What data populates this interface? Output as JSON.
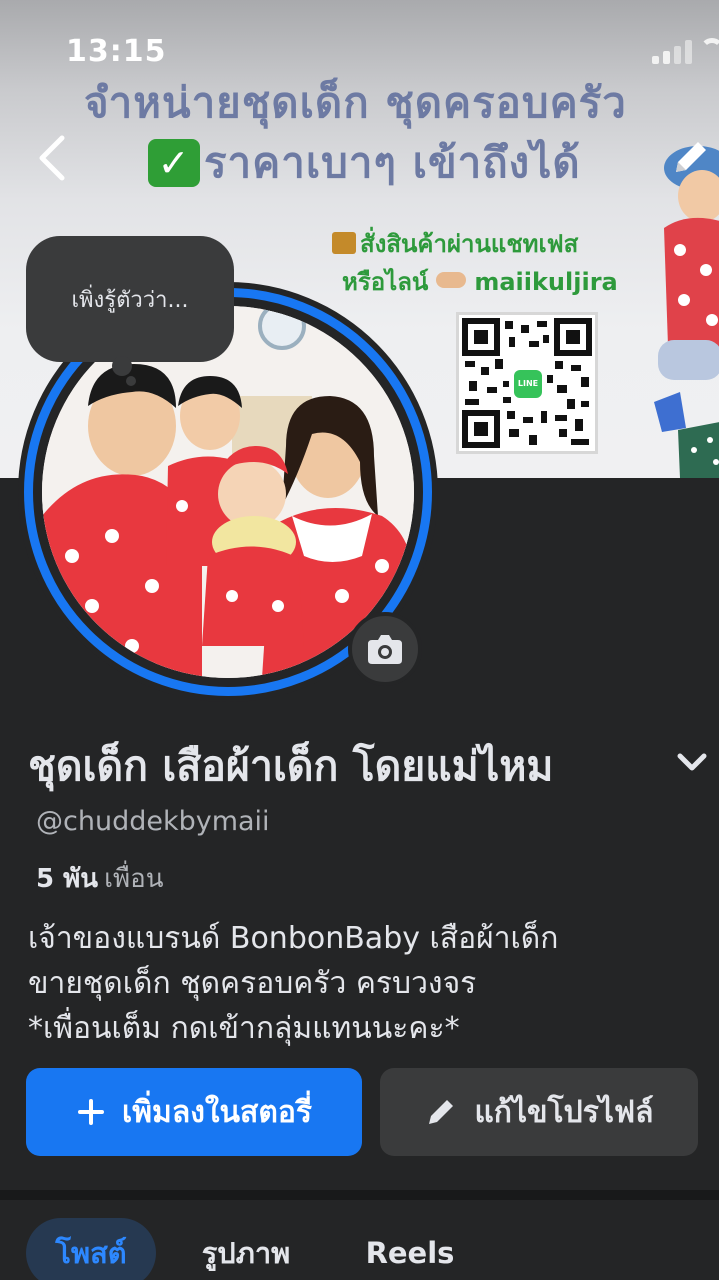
{
  "status_bar": {
    "time": "13:15"
  },
  "cover": {
    "headline_line1": "จำหน่ายชุดเด็ก ชุดครอบครัว",
    "headline_line2_check": "✅",
    "headline_line2": "ราคาเบาๆ เข้าถึงได้",
    "order_line1": "สั่งสินค้าผ่านแชทเฟส",
    "order_line2_prefix": "หรือไลน์",
    "order_line2_id": "maiikuljira",
    "qr_logo_text": "LINE"
  },
  "note": {
    "text": "เพิ่งรู้ตัวว่า..."
  },
  "profile": {
    "name": "ชุดเด็ก เสือผ้าเด็ก โดยแม่ไหม",
    "handle": "@chuddekbymaii",
    "friends_count": "5 พัน",
    "friends_label": "เพื่อน",
    "bio": [
      "เจ้าของแบรนด์ BonbonBaby เสือผ้าเด็ก",
      "ขายชุดเด็ก ชุดครอบครัว ครบวงจร",
      "*เพื่อนเต็ม กดเข้ากลุ่มแทนนะคะ*"
    ]
  },
  "actions": {
    "add_story": "เพิ่มลงในสตอรี่",
    "edit_profile": "แก้ไขโปรไฟล์"
  },
  "tabs": [
    {
      "label": "โพสต์",
      "active": true
    },
    {
      "label": "รูปภาพ",
      "active": false
    },
    {
      "label": "Reels",
      "active": false
    }
  ],
  "colors": {
    "background": "#242526",
    "accent_blue": "#1877f2",
    "secondary_button": "#3a3b3c",
    "active_tab_bg": "#263951"
  },
  "icons": [
    "back-icon",
    "edit-cover-icon",
    "camera-icon",
    "chevron-down-icon",
    "plus-icon",
    "pencil-icon"
  ]
}
